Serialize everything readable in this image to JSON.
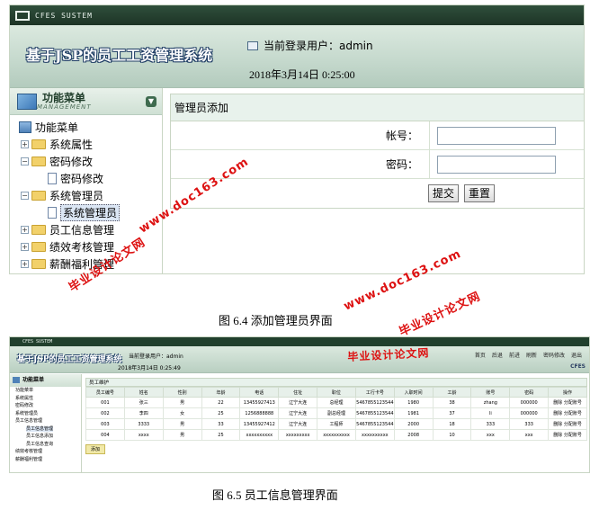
{
  "figure1": {
    "app_code": "CFES SUSTEM",
    "system_name": "基于JSP的员工工资管理系统",
    "current_user": "当前登录用户：admin",
    "datetime": "2018年3月14日  0:25:00",
    "menu": {
      "title": "功能菜单",
      "subtitle": "MANAGEMENT",
      "root": "功能菜单",
      "items": [
        {
          "label": "系统属性",
          "expander": "+"
        },
        {
          "label": "密码修改",
          "expander": "−"
        },
        {
          "label": "密码修改",
          "child": true
        },
        {
          "label": "系统管理员",
          "expander": "−"
        },
        {
          "label": "系统管理员",
          "child": true,
          "selected": true
        },
        {
          "label": "员工信息管理",
          "expander": "+"
        },
        {
          "label": "绩效考核管理",
          "expander": "+"
        },
        {
          "label": "薪酬福利管理",
          "expander": "+"
        }
      ]
    },
    "form": {
      "title": "管理员添加",
      "account_label": "帐号：",
      "password_label": "密码：",
      "submit": "提交",
      "reset": "重置"
    },
    "caption": "图 6.4 添加管理员界面"
  },
  "figure2": {
    "app_code": "CFES SUSTEM",
    "system_name": "基于JSP的员工工资管理系统",
    "current_user": "当前登录用户：admin",
    "datetime": "2018年3月14日  0:25:49",
    "toolbar": [
      "首页",
      "后退",
      "前进",
      "刷新",
      "密码修改",
      "退出"
    ],
    "brand": "CFES",
    "menu": {
      "title": "功能菜单",
      "items": [
        {
          "label": "功能菜单"
        },
        {
          "label": "系统属性"
        },
        {
          "label": "密码修改"
        },
        {
          "label": "系统管理员"
        },
        {
          "label": "员工信息管理"
        },
        {
          "label": "员工信息管理",
          "child": true,
          "selected": true
        },
        {
          "label": "员工信息添加",
          "child": true
        },
        {
          "label": "员工信息查询",
          "child": true
        },
        {
          "label": "绩效考核管理"
        },
        {
          "label": "薪酬福利管理"
        }
      ]
    },
    "panel_title": "员工维护",
    "columns": [
      "员工编号",
      "姓名",
      "性别",
      "年龄",
      "电话",
      "住址",
      "职位",
      "工行卡号",
      "入职时间",
      "工龄",
      "账号",
      "密码",
      "操作"
    ],
    "rows": [
      [
        "001",
        "张三",
        "男",
        "22",
        "13455927413",
        "辽宁大连",
        "总经理",
        "5467855123544",
        "1980",
        "38",
        "zhang",
        "000000",
        "删除 分配账号"
      ],
      [
        "002",
        "李四",
        "女",
        "25",
        "1256888888",
        "辽宁大连",
        "副总经理",
        "5467855123544",
        "1981",
        "37",
        "li",
        "000000",
        "删除 分配账号"
      ],
      [
        "003",
        "3333",
        "男",
        "33",
        "13455927412",
        "辽宁大连",
        "工程师",
        "5467855123544",
        "2000",
        "18",
        "333",
        "333",
        "删除 分配账号"
      ],
      [
        "004",
        "xxxx",
        "男",
        "25",
        "xxxxxxxxxx",
        "xxxxxxxxx",
        "xxxxxxxxxx",
        "xxxxxxxxxx",
        "2008",
        "10",
        "xxx",
        "xxx",
        "删除 分配账号"
      ]
    ],
    "add_button": "添加",
    "caption": "图 6.5 员工信息管理界面"
  },
  "watermarks": {
    "domain": "www.doc163.com",
    "site": "毕业设计论文网"
  }
}
